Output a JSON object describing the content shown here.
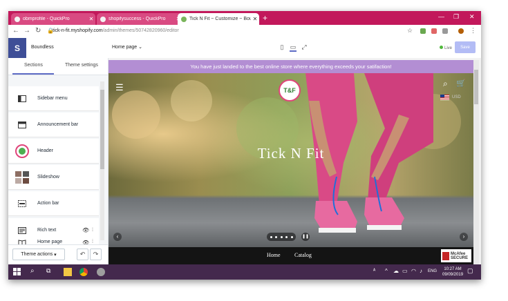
{
  "browser": {
    "tabs": [
      {
        "title": "obmprofile - QuickPro",
        "active": false
      },
      {
        "title": "shopifysuccess - QuickPro",
        "active": false
      },
      {
        "title": "Tick N Fit ~ Customize ~ Boundl",
        "active": true
      }
    ],
    "url_host": "tick-n-fit.myshopify.com",
    "url_path": "/admin/themes/50742820960/editor",
    "accent_color": "#c2185b"
  },
  "editor": {
    "theme_name": "Boundless",
    "page_selector": "Home page",
    "live_label": "Live",
    "save_label": "Save"
  },
  "sidebar": {
    "tabs": [
      "Sections",
      "Theme settings"
    ],
    "items": [
      {
        "label": "Sidebar menu",
        "icon": "sidebar-icon"
      },
      {
        "label": "Announcement bar",
        "icon": "announcement-icon"
      },
      {
        "label": "Header",
        "icon": "logo-thumbnail"
      },
      {
        "label": "Slideshow",
        "icon": "slideshow-thumbnail"
      },
      {
        "label": "Action bar",
        "icon": "action-bar-icon"
      },
      {
        "label": "Rich text",
        "icon": "rich-text-icon"
      },
      {
        "label": "Home page",
        "icon": "book-icon"
      }
    ],
    "theme_actions_label": "Theme actions"
  },
  "preview": {
    "announcement": "You have just landed to the best online store where everything exceeds your satifaction!",
    "currency": "USD",
    "hero_title": "Tick N Fit",
    "logo_text": "T&F",
    "nav_links": [
      "Home",
      "Catalog"
    ],
    "badge_line1": "McAfee",
    "badge_line2": "SECURE"
  },
  "taskbar": {
    "time": "10:27 AM",
    "date": "09/09/2019",
    "language": "ENG"
  }
}
